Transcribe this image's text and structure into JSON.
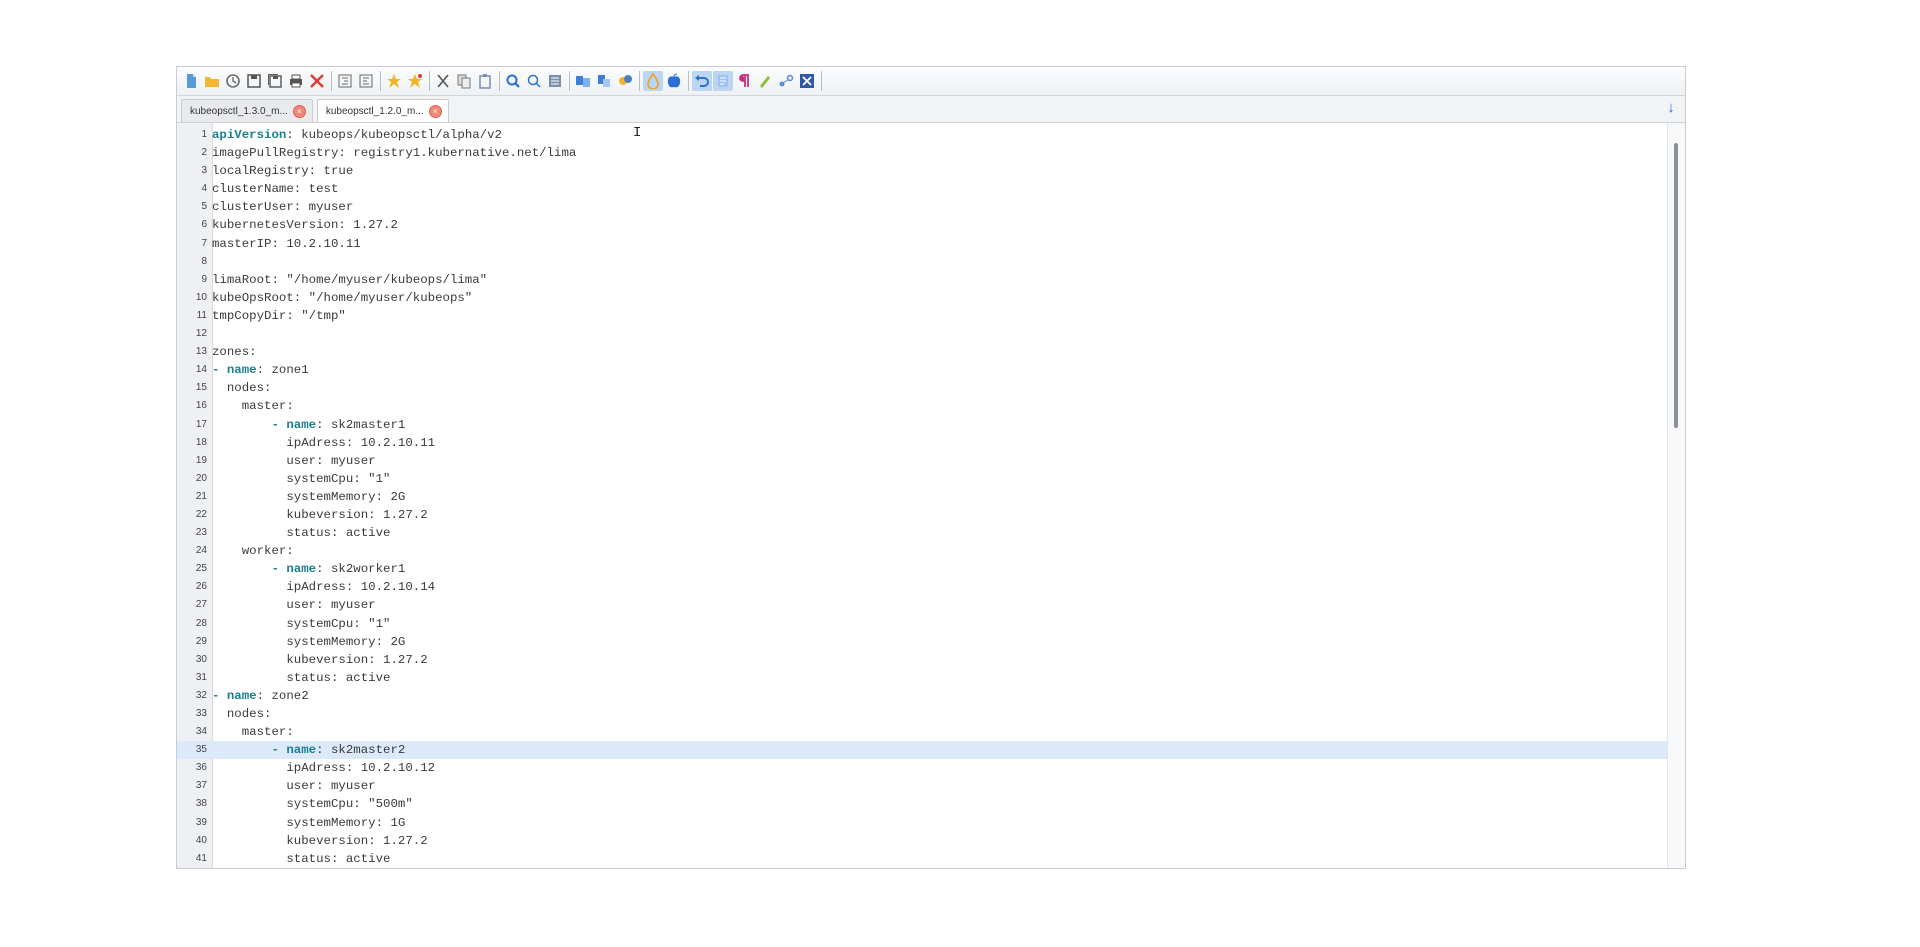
{
  "toolbar": {
    "buttons": [
      {
        "icon": "new-file-icon",
        "color": "#5b9bd5"
      },
      {
        "icon": "open-folder-icon",
        "color": "#f2b632"
      },
      {
        "icon": "clock-icon",
        "color": "#6b6b6b"
      },
      {
        "icon": "save-icon",
        "color": "#555555"
      },
      {
        "icon": "save-all-icon",
        "color": "#555555"
      },
      {
        "icon": "print-icon",
        "color": "#555555"
      },
      {
        "icon": "close-file-icon",
        "color": "#e03a2f"
      },
      {
        "icon": "indent-left-icon",
        "color": "#666666"
      },
      {
        "icon": "indent-right-icon",
        "color": "#666666"
      },
      {
        "icon": "bookmark-icon",
        "color": "#f0b429"
      },
      {
        "icon": "bookmark-next-icon",
        "color": "#f0b429"
      },
      {
        "icon": "cut-icon",
        "color": "#555555"
      },
      {
        "icon": "copy-icon",
        "color": "#777777"
      },
      {
        "icon": "paste-icon",
        "color": "#7a8fb0"
      },
      {
        "icon": "find-icon",
        "color": "#2a6fd6"
      },
      {
        "icon": "find-next-icon",
        "color": "#2a6fd6"
      },
      {
        "icon": "replace-icon",
        "color": "#7a8fb0"
      },
      {
        "icon": "compare-icon",
        "color": "#3c7dd9"
      },
      {
        "icon": "merge-icon",
        "color": "#3c7dd9"
      },
      {
        "icon": "macro-icon",
        "color": "#4a7fc1"
      },
      {
        "icon": "linux-icon",
        "color": "#f0a020",
        "active": true
      },
      {
        "icon": "apple-icon",
        "color": "#2a6fd6"
      },
      {
        "icon": "undo-icon",
        "color": "#2a6fd6",
        "active": true
      },
      {
        "icon": "redo-icon",
        "color": "#2a6fd6",
        "active": true
      },
      {
        "icon": "paragraph-icon",
        "color": "#cc2f7a"
      },
      {
        "icon": "highlight-icon",
        "color": "#8bbd32"
      },
      {
        "icon": "tools-icon",
        "color": "#5a8fd6"
      },
      {
        "icon": "exit-icon",
        "color": "#2f58a8"
      }
    ]
  },
  "tabs": [
    {
      "label": "kubeopsctl_1.3.0_m...",
      "active": false
    },
    {
      "label": "kubeopsctl_1.2.0_m...",
      "active": true
    }
  ],
  "tabs_menu_glyph": "↓",
  "editor": {
    "current_line": 35,
    "lines": [
      {
        "n": "1",
        "indent": "",
        "key": "apiVersion",
        "rest": ": kubeops/kubeopsctl/alpha/v2",
        "hl": true
      },
      {
        "n": "2",
        "text": "imagePullRegistry: registry1.kubernative.net/lima"
      },
      {
        "n": "3",
        "text": "localRegistry: true"
      },
      {
        "n": "4",
        "text": "clusterName: test"
      },
      {
        "n": "5",
        "text": "clusterUser: myuser"
      },
      {
        "n": "6",
        "text": "kubernetesVersion: 1.27.2"
      },
      {
        "n": "7",
        "text": "masterIP: 10.2.10.11"
      },
      {
        "n": "8",
        "text": ""
      },
      {
        "n": "9",
        "text": "limaRoot: \"/home/myuser/kubeops/lima\""
      },
      {
        "n": "10",
        "text": "kubeOpsRoot: \"/home/myuser/kubeops\""
      },
      {
        "n": "11",
        "text": "tmpCopyDir: \"/tmp\""
      },
      {
        "n": "12",
        "text": ""
      },
      {
        "n": "13",
        "text": "zones:"
      },
      {
        "n": "14",
        "indent": "- ",
        "key": "name",
        "rest": ": zone1",
        "hl": true
      },
      {
        "n": "15",
        "text": "  nodes:"
      },
      {
        "n": "16",
        "text": "    master:"
      },
      {
        "n": "17",
        "indent": "        - ",
        "key": "name",
        "rest": ": sk2master1",
        "hl": true
      },
      {
        "n": "18",
        "text": "          ipAdress: 10.2.10.11"
      },
      {
        "n": "19",
        "text": "          user: myuser"
      },
      {
        "n": "20",
        "text": "          systemCpu: \"1\""
      },
      {
        "n": "21",
        "text": "          systemMemory: 2G"
      },
      {
        "n": "22",
        "text": "          kubeversion: 1.27.2"
      },
      {
        "n": "23",
        "text": "          status: active"
      },
      {
        "n": "24",
        "text": "    worker:"
      },
      {
        "n": "25",
        "indent": "        - ",
        "key": "name",
        "rest": ": sk2worker1",
        "hl": true
      },
      {
        "n": "26",
        "text": "          ipAdress: 10.2.10.14"
      },
      {
        "n": "27",
        "text": "          user: myuser"
      },
      {
        "n": "28",
        "text": "          systemCpu: \"1\""
      },
      {
        "n": "29",
        "text": "          systemMemory: 2G"
      },
      {
        "n": "30",
        "text": "          kubeversion: 1.27.2"
      },
      {
        "n": "31",
        "text": "          status: active"
      },
      {
        "n": "32",
        "indent": "- ",
        "key": "name",
        "rest": ": zone2",
        "hl": true
      },
      {
        "n": "33",
        "text": "  nodes:"
      },
      {
        "n": "34",
        "text": "    master:"
      },
      {
        "n": "35",
        "indent": "        - ",
        "key": "name",
        "rest": ": sk2master2",
        "hl": true
      },
      {
        "n": "36",
        "text": "          ipAdress: 10.2.10.12"
      },
      {
        "n": "37",
        "text": "          user: myuser"
      },
      {
        "n": "38",
        "text": "          systemCpu: \"500m\""
      },
      {
        "n": "39",
        "text": "          systemMemory: 1G"
      },
      {
        "n": "40",
        "text": "          kubeversion: 1.27.2"
      },
      {
        "n": "41",
        "text": "          status: active"
      }
    ]
  }
}
